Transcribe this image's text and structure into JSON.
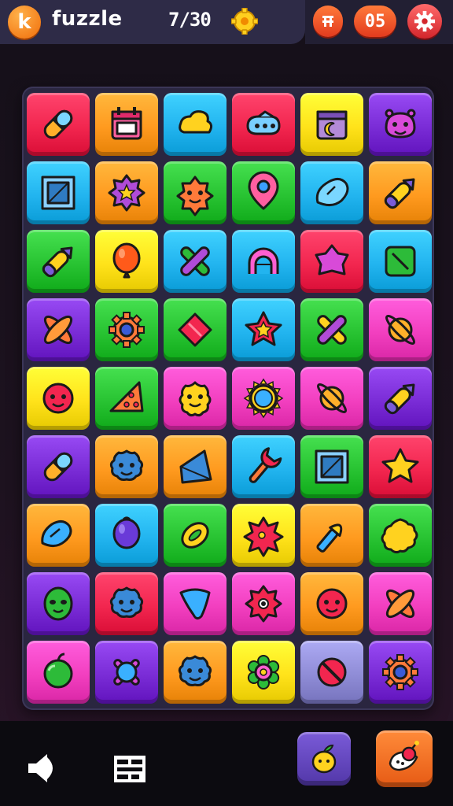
{
  "header": {
    "logo_letter": "k",
    "title": "fuzzle",
    "progress": "7/30",
    "moves": "05",
    "settings_icon": "gear-icon",
    "grid_icon": "grid-icon",
    "coin_icon": "gear-coin-icon"
  },
  "colors": {
    "red": "#f2264f",
    "orange": "#ff9a1f",
    "blue": "#22b4ef",
    "green": "#28c332",
    "yellow": "#ffe21a",
    "purple": "#7a2cd6",
    "magenta": "#f23fbf",
    "lavender": "#8f8cd6"
  },
  "board": {
    "columns": 6,
    "rows": 9,
    "tiles": [
      [
        "red:pill",
        "orange:calendar",
        "blue:cloud",
        "red:camera",
        "yellow:calendar-moon",
        "purple:face-monster"
      ],
      [
        "blue:frame",
        "orange:star-badge",
        "green:face-cookie",
        "green:pin",
        "blue:blob",
        "orange:pen"
      ],
      [
        "green:pen",
        "yellow:balloon",
        "blue:cross-sticks",
        "blue:arch",
        "red:star-blob",
        "blue:leaf-square"
      ],
      [
        "purple:cross-leaves",
        "green:gear",
        "green:diamond-red",
        "blue:star-red",
        "green:cross-ring",
        "magenta:saturn"
      ],
      [
        "yellow:face-red",
        "green:pizza",
        "magenta:face-smile",
        "magenta:sun",
        "magenta:saturn",
        "purple:pen"
      ],
      [
        "purple:pill",
        "orange:face-blue",
        "orange:diamond-blue",
        "blue:wrench",
        "green:frame",
        "red:star-yellow"
      ],
      [
        "orange:blob-blue",
        "blue:balloon-purple",
        "green:ring",
        "yellow:splat",
        "orange:brush",
        "green:cookie"
      ],
      [
        "purple:face-alien",
        "red:face-blue",
        "magenta:drop",
        "magenta:eye-red",
        "orange:face-red",
        "magenta:cross-leaves"
      ],
      [
        "magenta:apple",
        "purple:burst",
        "orange:face-blue",
        "yellow:gear-flower",
        "lavender:no-sign",
        "purple:gear"
      ]
    ]
  },
  "bottom": {
    "sound_icon": "speaker-icon",
    "menu_icon": "grid-menu-icon",
    "hint_icon": "lemon-hint-icon",
    "bomb_icon": "bomb-card-icon"
  }
}
